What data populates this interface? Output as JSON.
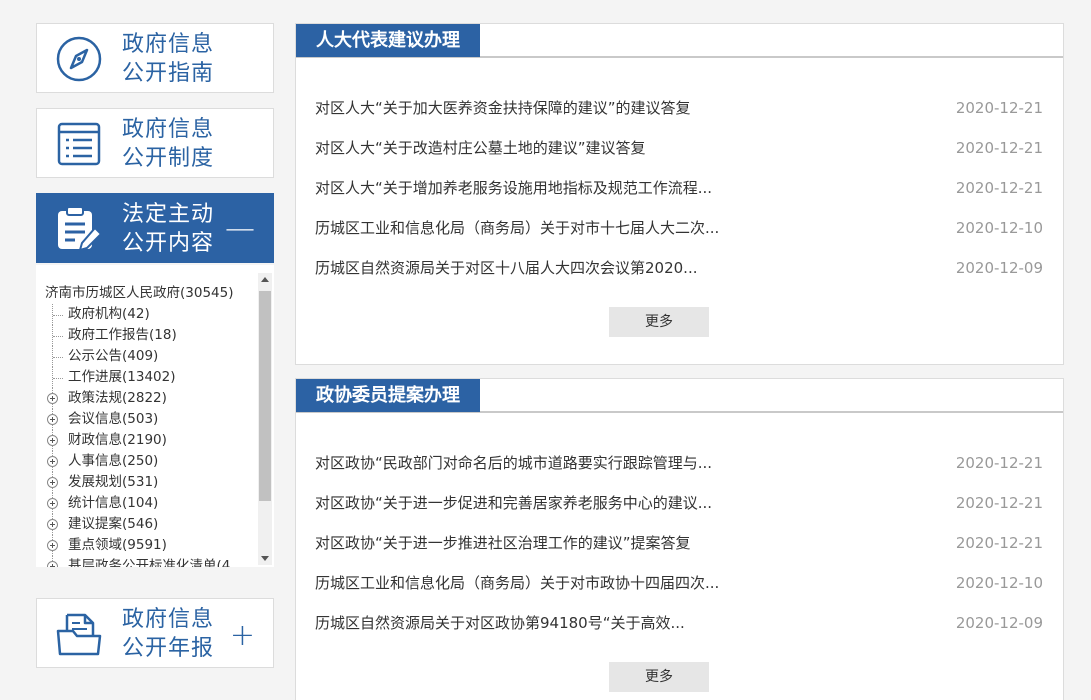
{
  "sidebar": {
    "cards": [
      {
        "line1": "政府信息",
        "line2": "公开指南"
      },
      {
        "line1": "政府信息",
        "line2": "公开制度"
      },
      {
        "line1": "法定主动",
        "line2": "公开内容",
        "sign": "—"
      },
      {
        "line1": "政府信息",
        "line2": "公开年报",
        "sign": "+"
      }
    ],
    "tree": {
      "root": "济南市历城区人民政府(30545)",
      "nodes": [
        {
          "label": "政府机构(42)",
          "expandable": false
        },
        {
          "label": "政府工作报告(18)",
          "expandable": false
        },
        {
          "label": "公示公告(409)",
          "expandable": false
        },
        {
          "label": "工作进展(13402)",
          "expandable": false
        },
        {
          "label": "政策法规(2822)",
          "expandable": true
        },
        {
          "label": "会议信息(503)",
          "expandable": true
        },
        {
          "label": "财政信息(2190)",
          "expandable": true
        },
        {
          "label": "人事信息(250)",
          "expandable": true
        },
        {
          "label": "发展规划(531)",
          "expandable": true
        },
        {
          "label": "统计信息(104)",
          "expandable": true
        },
        {
          "label": "建议提案(546)",
          "expandable": true
        },
        {
          "label": "重点领域(9591)",
          "expandable": true
        },
        {
          "label": "基层政务公开标准化清单(4",
          "expandable": true
        }
      ]
    }
  },
  "panels": [
    {
      "title": "人大代表建议办理",
      "items": [
        {
          "title": "对区人大“关于加大医养资金扶持保障的建议”的建议答复",
          "date": "2020-12-21"
        },
        {
          "title": "对区人大“关于改造村庄公墓土地的建议”建议答复",
          "date": "2020-12-21"
        },
        {
          "title": "对区人大“关于增加养老服务设施用地指标及规范工作流程...",
          "date": "2020-12-21"
        },
        {
          "title": "历城区工业和信息化局（商务局）关于对市十七届人大二次...",
          "date": "2020-12-10"
        },
        {
          "title": "历城区自然资源局关于对区十八届人大四次会议第2020...",
          "date": "2020-12-09"
        }
      ],
      "more": "更多"
    },
    {
      "title": "政协委员提案办理",
      "items": [
        {
          "title": "对区政协“民政部门对命名后的城市道路要实行跟踪管理与...",
          "date": "2020-12-21"
        },
        {
          "title": "对区政协“关于进一步促进和完善居家养老服务中心的建议...",
          "date": "2020-12-21"
        },
        {
          "title": "对区政协“关于进一步推进社区治理工作的建议”提案答复",
          "date": "2020-12-21"
        },
        {
          "title": "历城区工业和信息化局（商务局）关于对市政协十四届四次...",
          "date": "2020-12-10"
        },
        {
          "title": "历城区自然资源局关于对区政协第94180号“关于高效...",
          "date": "2020-12-09"
        }
      ],
      "more": "更多"
    }
  ]
}
